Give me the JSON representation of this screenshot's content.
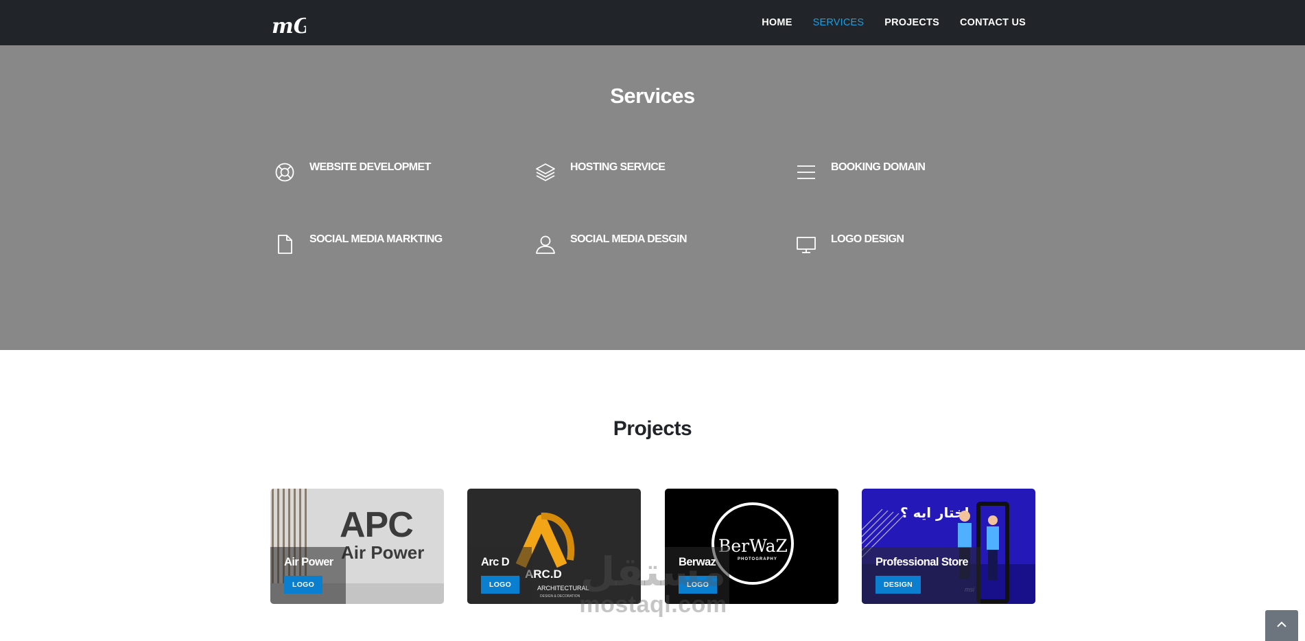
{
  "nav": {
    "logo_text": "mG",
    "links": [
      {
        "label": "HOME",
        "active": false
      },
      {
        "label": "SERVICES",
        "active": true
      },
      {
        "label": "PROJECTS",
        "active": false
      },
      {
        "label": "CONTACT US",
        "active": false
      }
    ]
  },
  "services": {
    "title": "Services",
    "items": [
      {
        "label": "WEBSITE DEVELOPMET",
        "icon": "lifebuoy-icon"
      },
      {
        "label": "HOSTING SERVICE",
        "icon": "layers-icon"
      },
      {
        "label": "BOOKING DOMAIN",
        "icon": "menu-icon"
      },
      {
        "label": "SOCIAL MEDIA MARKTING",
        "icon": "document-icon"
      },
      {
        "label": "SOCIAL MEDIA DESGIN",
        "icon": "user-icon"
      },
      {
        "label": "LOGO DESIGN",
        "icon": "monitor-icon"
      }
    ]
  },
  "projects": {
    "title": "Projects",
    "cards": [
      {
        "title": "Air Power",
        "tag": "LOGO",
        "image_text_1": "APC",
        "image_text_2": "Air Power"
      },
      {
        "title": "Arc D",
        "tag": "LOGO",
        "image_text_1": "ARC.D",
        "image_text_2": "ARCHITECTURAL",
        "image_text_3": "DESIGN & DECORATION"
      },
      {
        "title": "Berwaz",
        "tag": "LOGO",
        "image_text_1": "BerWaZ",
        "image_text_2": "PHOTOGRAPHY"
      },
      {
        "title": "Professional Store",
        "tag": "DESIGN",
        "image_text_1": "اختار ايه ؟",
        "image_text_2": "msi"
      }
    ]
  },
  "watermark": {
    "arabic": "مستقل",
    "latin": "mostaql.com"
  },
  "colors": {
    "navbar": "#212529",
    "services_bg": "#888888",
    "accent": "#1e9de0",
    "tag_bg": "#0a7fcf"
  }
}
